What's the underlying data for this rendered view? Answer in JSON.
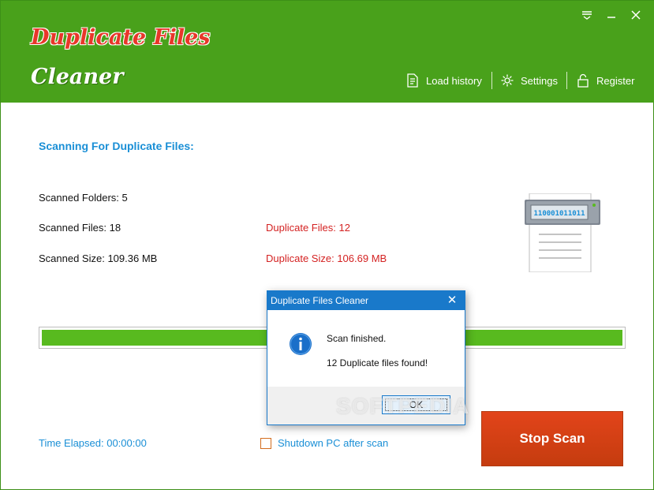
{
  "app": {
    "logo_line1": "Duplicate Files",
    "logo_line2": "Cleaner"
  },
  "window_controls": {
    "menu_icon": "menu-icon",
    "minimize_icon": "minimize-icon",
    "close_icon": "close-icon"
  },
  "nav": {
    "load_history": "Load history",
    "settings": "Settings",
    "register": "Register"
  },
  "scan": {
    "title": "Scanning For Duplicate Files:",
    "scanned_folders": "Scanned Folders: 5",
    "scanned_files": "Scanned Files: 18",
    "scanned_size": "Scanned Size: 109.36 MB",
    "duplicate_files": "Duplicate Files: 12",
    "duplicate_size": "Duplicate Size: 106.69 MB",
    "progress": 1.0,
    "binary_display": "110001011011"
  },
  "footer": {
    "time_elapsed": "Time Elapsed: 00:00:00",
    "shutdown_label": "Shutdown PC after scan",
    "shutdown_checked": false,
    "stop_label": "Stop Scan"
  },
  "dialog": {
    "title": "Duplicate Files Cleaner",
    "line1": "Scan finished.",
    "line2": "12 Duplicate files found!",
    "ok_label": "OK"
  },
  "watermark": "SOFTPEDIA",
  "colors": {
    "header_green": "#49a11b",
    "accent_blue": "#1a8fd6",
    "alert_red": "#d42222",
    "progress_green": "#58ba1f",
    "stop_orange": "#d4421a",
    "dialog_blue": "#1979ca"
  }
}
